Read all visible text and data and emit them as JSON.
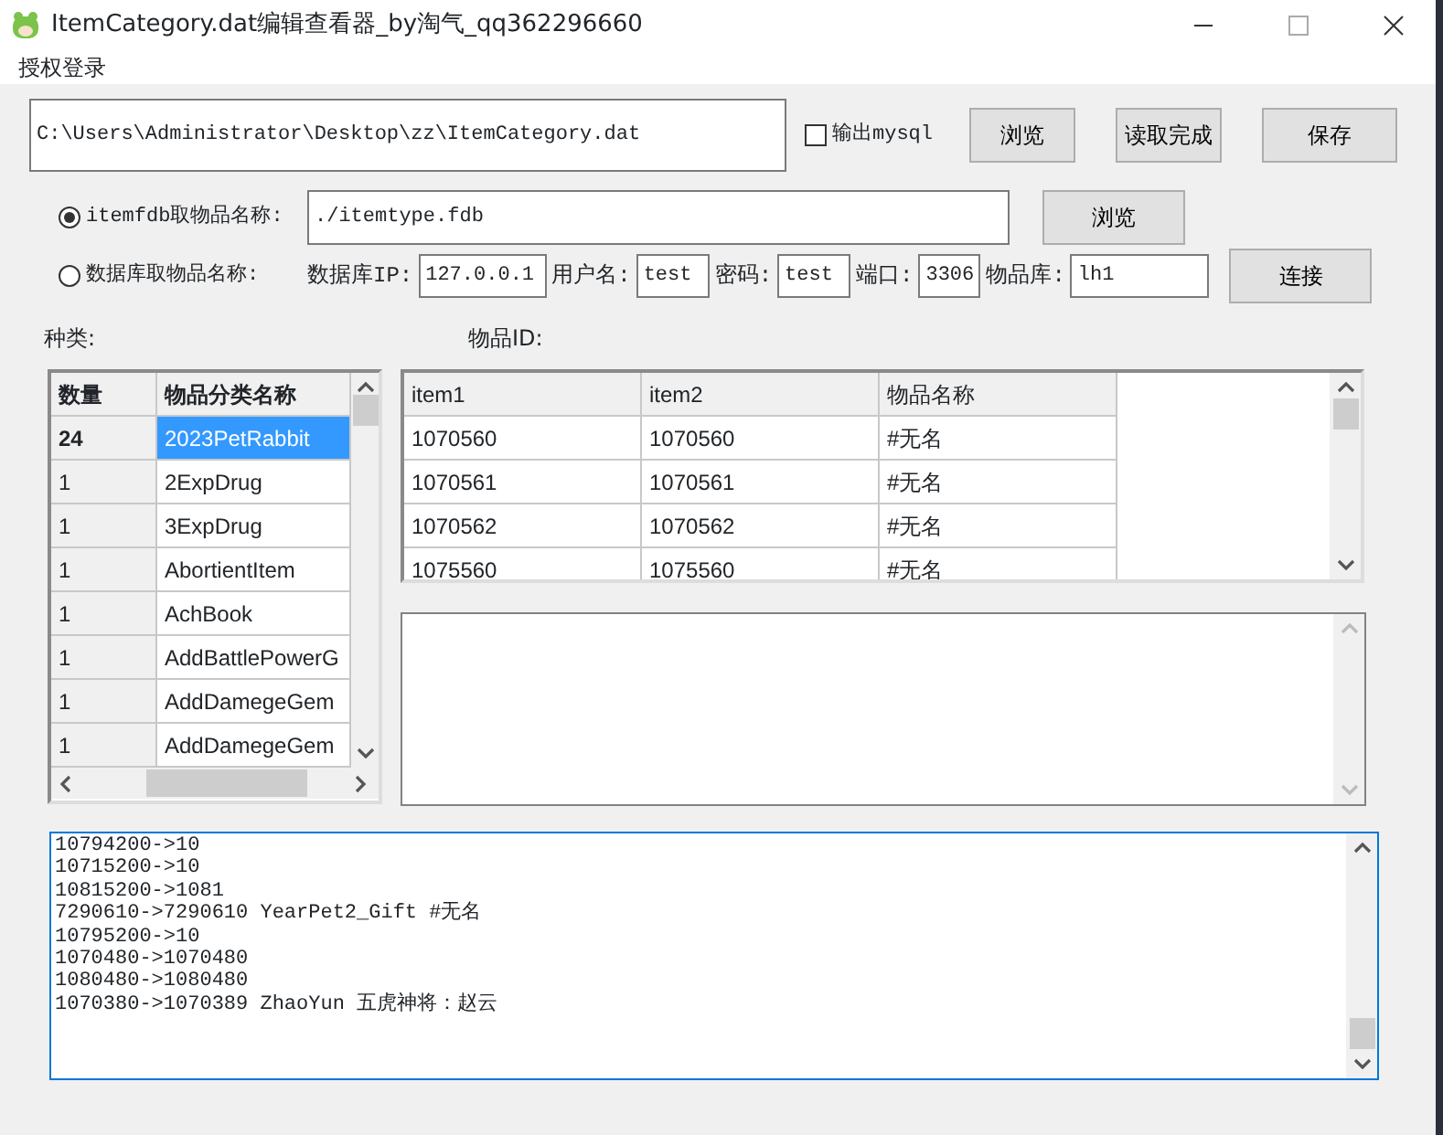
{
  "window": {
    "title": "ItemCategory.dat编辑查看器_by淘气_qq362296660"
  },
  "menu": [
    "授权登录"
  ],
  "file_path": {
    "value": "C:\\Users\\Administrator\\Desktop\\zz\\ItemCategory.dat"
  },
  "export_mysql": {
    "label": "输出mysql",
    "checked": false
  },
  "top_buttons": [
    "浏览",
    "读取完成",
    "保存"
  ],
  "sources": [
    {
      "label": "itemfdb取物品名称:",
      "selected": true
    },
    {
      "label": "数据库取物品名称:",
      "selected": false
    }
  ],
  "fdb_path": {
    "value": "./itemtype.fdb"
  },
  "fdb_button": "浏览",
  "db_fields": [
    {
      "label": "数据库IP:",
      "value": "127.0.0.1"
    },
    {
      "label": "用户名:",
      "value": "test"
    },
    {
      "label": "密码:",
      "value": "test"
    },
    {
      "label": "端口:",
      "value": "3306"
    },
    {
      "label": "物品库:",
      "value": "lh1"
    }
  ],
  "connect_button": "连接",
  "category_label": "种类:",
  "item_id_label": "物品ID:",
  "category_table": {
    "columns": [
      "数量",
      "物品分类名称"
    ],
    "rows": [
      {
        "cells": [
          "24",
          "2023PetRabbit"
        ],
        "selected": true
      },
      {
        "cells": [
          "1",
          "2ExpDrug"
        ],
        "selected": false
      },
      {
        "cells": [
          "1",
          "3ExpDrug"
        ],
        "selected": false
      },
      {
        "cells": [
          "1",
          "AbortientItem"
        ],
        "selected": false
      },
      {
        "cells": [
          "1",
          "AchBook"
        ],
        "selected": false
      },
      {
        "cells": [
          "1",
          "AddBattlePowerG"
        ],
        "selected": false
      },
      {
        "cells": [
          "1",
          "AddDamegeGem"
        ],
        "selected": false
      },
      {
        "cells": [
          "1",
          "AddDamegeGem"
        ],
        "selected": false
      }
    ]
  },
  "item_table": {
    "columns": [
      "item1",
      "item2",
      "物品名称"
    ],
    "rows": [
      [
        "1070560",
        "1070560",
        "#无名"
      ],
      [
        "1070561",
        "1070561",
        "#无名"
      ],
      [
        "1070562",
        "1070562",
        "#无名"
      ],
      [
        "1075560",
        "1075560",
        "#无名"
      ]
    ]
  },
  "log": [
    "10794200->10",
    "10715200->10",
    "10815200->1081",
    "7290610->7290610 YearPet2_Gift #无名",
    "10795200->10",
    "1070480->1070480",
    "1080480->1080480",
    "1070380->1070389 ZhaoYun 五虎神将：赵云"
  ]
}
